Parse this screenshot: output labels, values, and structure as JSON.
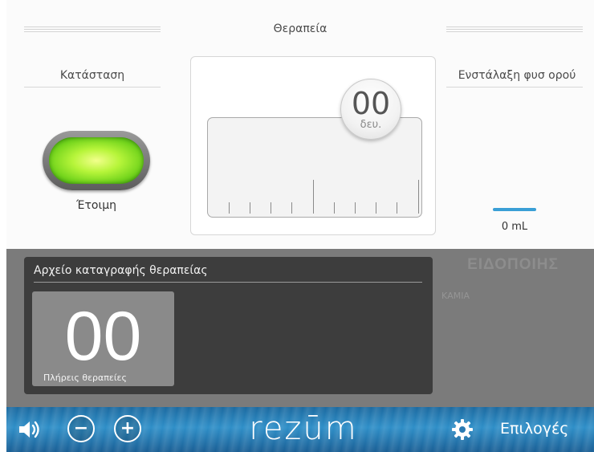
{
  "header": {
    "title": "Θεραπεία"
  },
  "status": {
    "heading": "Κατάσταση",
    "label": "Έτοιμη",
    "led_color": "#7fe024"
  },
  "timer": {
    "value": "00",
    "unit": "δευ."
  },
  "saline": {
    "heading": "Ενστάλαξη φυσ ορού",
    "value": "0 mL",
    "bar_color": "#3a9fd6"
  },
  "log": {
    "title": "Αρχείο καταγραφής θεραπείας",
    "count": "00",
    "count_label": "Πλήρεις θεραπείες"
  },
  "notifications": {
    "title": "ΕΙΔΟΠΟΙΗΣ",
    "value": "ΚΑΜΙΑ"
  },
  "footer": {
    "brand": "rezūm",
    "volume_icon": "speaker-volume-icon",
    "minus_icon": "minus-icon",
    "plus_icon": "plus-icon",
    "settings_icon": "gear-icon",
    "options_label": "Επιλογές"
  }
}
